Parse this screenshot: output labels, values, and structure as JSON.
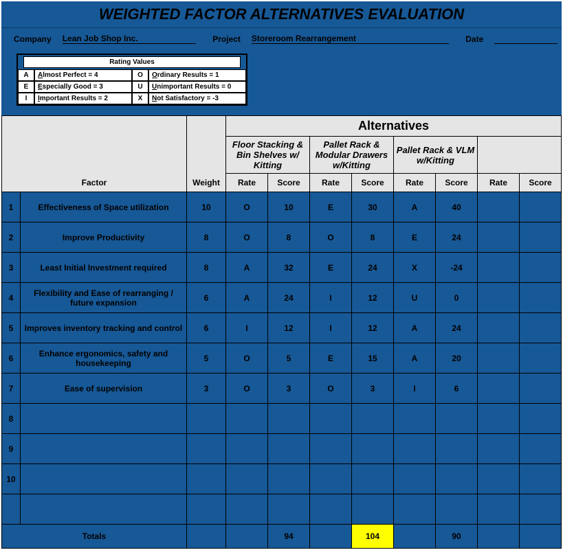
{
  "title": "WEIGHTED FACTOR ALTERNATIVES EVALUATION",
  "meta": {
    "companyLabel": "Company",
    "companyValue": "Lean Job Shop Inc.",
    "projectLabel": "Project",
    "projectValue": "Storeroom Rearrangement",
    "dateLabel": "Date",
    "dateValue": ""
  },
  "rating": {
    "title": "Rating Values",
    "rows": [
      {
        "c1": "A",
        "d1": "Almost Perfect = 4",
        "c2": "O",
        "d2": "Ordinary Results = 1"
      },
      {
        "c1": "E",
        "d1": "Especially Good = 3",
        "c2": "U",
        "d2": "Unimportant Results = 0"
      },
      {
        "c1": "I",
        "d1": "Important Results = 2",
        "c2": "X",
        "d2": "Not Satisfactory = -3"
      }
    ]
  },
  "table": {
    "factorLabel": "Factor",
    "weightLabel": "Weight",
    "alternativesLabel": "Alternatives",
    "rateLabel": "Rate",
    "scoreLabel": "Score",
    "alternatives": [
      "Floor Stacking & Bin Shelves w/ Kitting",
      "Pallet Rack & Modular Drawers w/Kitting",
      "Pallet Rack & VLM w/Kitting",
      ""
    ],
    "factors": [
      {
        "n": "1",
        "name": "Effectiveness of Space utilization",
        "weight": "10",
        "alts": [
          {
            "r": "O",
            "s": "10"
          },
          {
            "r": "E",
            "s": "30"
          },
          {
            "r": "A",
            "s": "40"
          },
          {
            "r": "",
            "s": ""
          }
        ]
      },
      {
        "n": "2",
        "name": "Improve Productivity",
        "weight": "8",
        "alts": [
          {
            "r": "O",
            "s": "8"
          },
          {
            "r": "O",
            "s": "8"
          },
          {
            "r": "E",
            "s": "24"
          },
          {
            "r": "",
            "s": ""
          }
        ]
      },
      {
        "n": "3",
        "name": "Least Initial Investment required",
        "weight": "8",
        "alts": [
          {
            "r": "A",
            "s": "32"
          },
          {
            "r": "E",
            "s": "24"
          },
          {
            "r": "X",
            "s": "-24"
          },
          {
            "r": "",
            "s": ""
          }
        ]
      },
      {
        "n": "4",
        "name": "Flexibility and Ease of rearranging / future expansion",
        "weight": "6",
        "alts": [
          {
            "r": "A",
            "s": "24"
          },
          {
            "r": "I",
            "s": "12"
          },
          {
            "r": "U",
            "s": "0"
          },
          {
            "r": "",
            "s": ""
          }
        ]
      },
      {
        "n": "5",
        "name": "Improves inventory tracking and control",
        "weight": "6",
        "alts": [
          {
            "r": "I",
            "s": "12"
          },
          {
            "r": "I",
            "s": "12"
          },
          {
            "r": "A",
            "s": "24"
          },
          {
            "r": "",
            "s": ""
          }
        ]
      },
      {
        "n": "6",
        "name": "Enhance ergonomics, safety and housekeeping",
        "weight": "5",
        "alts": [
          {
            "r": "O",
            "s": "5"
          },
          {
            "r": "E",
            "s": "15"
          },
          {
            "r": "A",
            "s": "20"
          },
          {
            "r": "",
            "s": ""
          }
        ]
      },
      {
        "n": "7",
        "name": "Ease of supervision",
        "weight": "3",
        "alts": [
          {
            "r": "O",
            "s": "3"
          },
          {
            "r": "O",
            "s": "3"
          },
          {
            "r": "I",
            "s": "6"
          },
          {
            "r": "",
            "s": ""
          }
        ]
      },
      {
        "n": "8",
        "name": "",
        "weight": "",
        "alts": [
          {
            "r": "",
            "s": ""
          },
          {
            "r": "",
            "s": ""
          },
          {
            "r": "",
            "s": ""
          },
          {
            "r": "",
            "s": ""
          }
        ]
      },
      {
        "n": "9",
        "name": "",
        "weight": "",
        "alts": [
          {
            "r": "",
            "s": ""
          },
          {
            "r": "",
            "s": ""
          },
          {
            "r": "",
            "s": ""
          },
          {
            "r": "",
            "s": ""
          }
        ]
      },
      {
        "n": "10",
        "name": "",
        "weight": "",
        "alts": [
          {
            "r": "",
            "s": ""
          },
          {
            "r": "",
            "s": ""
          },
          {
            "r": "",
            "s": ""
          },
          {
            "r": "",
            "s": ""
          }
        ]
      },
      {
        "n": "",
        "name": "",
        "weight": "",
        "alts": [
          {
            "r": "",
            "s": ""
          },
          {
            "r": "",
            "s": ""
          },
          {
            "r": "",
            "s": ""
          },
          {
            "r": "",
            "s": ""
          }
        ]
      }
    ],
    "totalsLabel": "Totals",
    "totals": [
      "94",
      "104",
      "90",
      ""
    ],
    "highlight": 1
  }
}
